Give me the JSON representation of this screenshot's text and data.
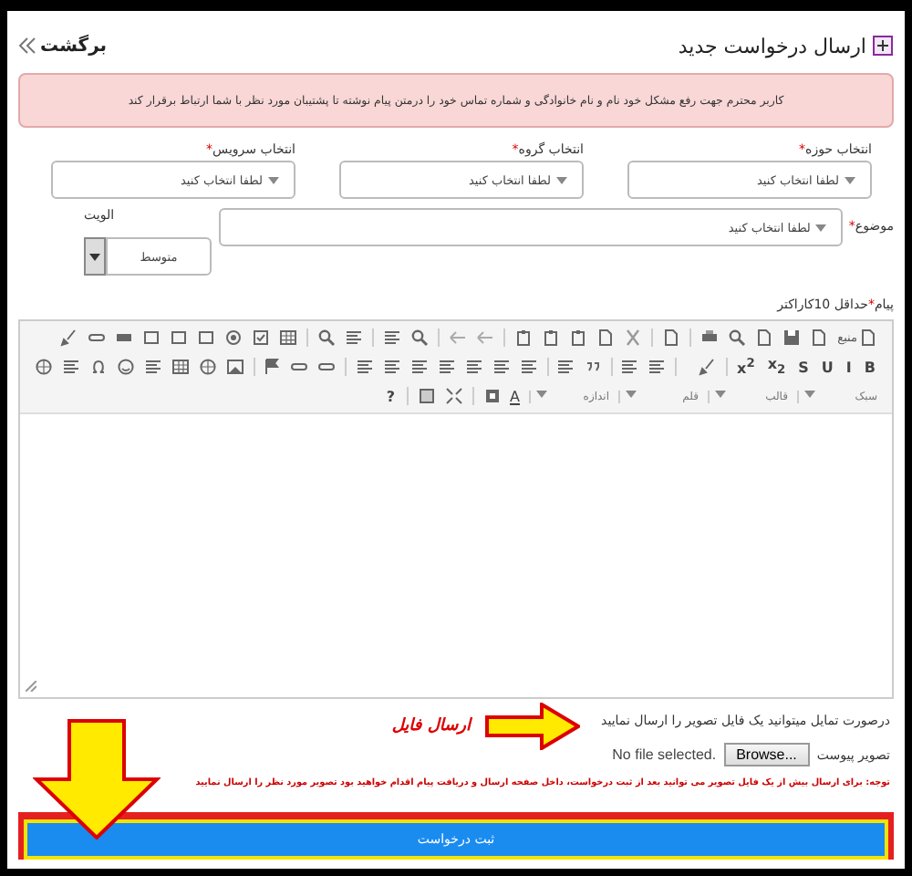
{
  "header": {
    "title": "ارسال درخواست جدید",
    "back_link": "برگشت"
  },
  "alert": "کاربر محترم جهت رفع مشکل خود نام و نام خانوادگی و شماره تماس خود را درمتن پیام نوشته تا پشتیبان مورد نظر با شما ارتباط برقرار کند",
  "selects": [
    {
      "label": "انتخاب حوزه",
      "required_mark": "*",
      "value": "لطفا انتخاب کنید"
    },
    {
      "label": "انتخاب گروه",
      "required_mark": "*",
      "value": "لطفا انتخاب کنید"
    },
    {
      "label": "انتخاب سرویس",
      "required_mark": "*",
      "value": "لطفا انتخاب کنید"
    }
  ],
  "subject": {
    "label": "موضوع",
    "required_mark": "*",
    "value": "لطفا انتخاب کنید"
  },
  "priority": {
    "label": "الویت",
    "value": "متوسط"
  },
  "message": {
    "label": "پیام",
    "required_mark": "*",
    "hint": "حداقل 10کاراکتر"
  },
  "editor": {
    "source_button": "منبع",
    "format_buttons": [
      "B",
      "I",
      "U",
      "S",
      "x$_{2}$",
      "x$^{2}$"
    ],
    "dropdowns": [
      "سبک",
      "قالب",
      "قلم",
      "اندازه"
    ],
    "color_button": "A",
    "help_button": "?"
  },
  "attachment": {
    "intro": "درصورت تمایل میتوانید یک فایل تصویر را ارسال نمایید",
    "label": "تصویر پیوست",
    "file_status": "No file selected.",
    "browse_button": "Browse...",
    "note": "توجه: برای ارسال بیش از یک فایل تصویر می توانید بعد از ثبت درخواست، داخل صفحه ارسال و دریافت پیام اقدام خواهید بود تصویر مورد نظر را ارسال نمایید"
  },
  "annotation": {
    "label": "ارسال فایل"
  },
  "submit_button": "ثبت درخواست"
}
